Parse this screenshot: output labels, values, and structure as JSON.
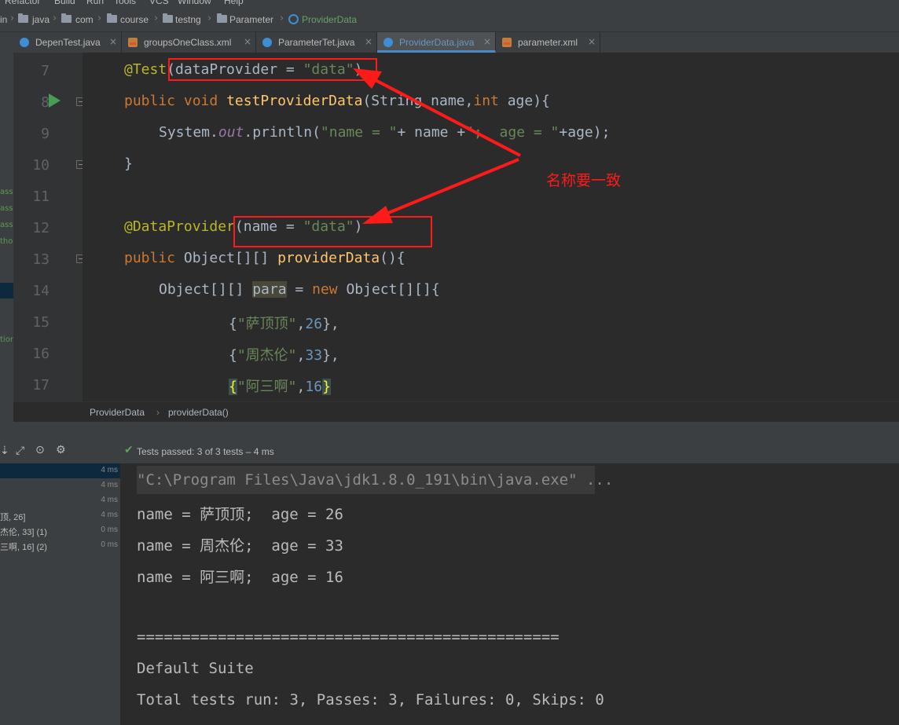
{
  "menu": [
    "Refactor",
    "Build",
    "Run",
    "Tools",
    "VCS",
    "Window",
    "Help"
  ],
  "breadcrumb": [
    "in",
    "java",
    "com",
    "course",
    "testng",
    "Parameter",
    "ProviderData"
  ],
  "tabs": [
    {
      "label": "DepenTest.java",
      "icon": "java-class-icon",
      "active": false
    },
    {
      "label": "groupsOneClass.xml",
      "icon": "xml-file-icon",
      "active": false
    },
    {
      "label": "ParameterTet.java",
      "icon": "java-class-icon",
      "active": false
    },
    {
      "label": "ProviderData.java",
      "icon": "java-class-icon",
      "active": true
    },
    {
      "label": "parameter.xml",
      "icon": "xml-file-icon",
      "active": false
    }
  ],
  "left_edge_labels": [
    "ass",
    "ass",
    "ass",
    "tho",
    "tion"
  ],
  "line_numbers": [
    "7",
    "8",
    "9",
    "10",
    "11",
    "12",
    "13",
    "14",
    "15",
    "16",
    "17"
  ],
  "code": {
    "l7": {
      "ann": "@Test",
      "rest": "(dataProvider = ",
      "str": "\"data\"",
      "end": ")"
    },
    "l8": {
      "kw1": "public",
      "kw2": "void",
      "name": "testProviderData",
      "p1": "(String name,",
      "kw3": "int",
      "p2": " age){"
    },
    "l9": {
      "pre": "System.",
      "fld": "out",
      "mid": ".println(",
      "s1": "\"name = \"",
      "mid2": "+ name +",
      "s2": "\";  age = \"",
      "end": "+age);"
    },
    "l10": "}",
    "l12": {
      "ann": "@DataProvider",
      "rest": "(name = ",
      "str": "\"data\"",
      "end": ")"
    },
    "l13": {
      "kw": "public",
      "type": " Object[][] ",
      "name": "providerData",
      "end": "(){"
    },
    "l14": {
      "pre": "Object[][] ",
      "var": "para",
      "mid": " = ",
      "kw": "new",
      "end": " Object[][]{"
    },
    "l15": {
      "s": "\"萨顶顶\"",
      "n": "26"
    },
    "l16": {
      "s": "\"周杰伦\"",
      "n": "33"
    },
    "l17": {
      "s": "\"阿三啊\"",
      "n": "16"
    }
  },
  "status_crumbs": [
    "ProviderData",
    "providerData()"
  ],
  "test_summary": "Tests passed: 3 of 3 tests – 4 ms",
  "tree_rows": [
    {
      "name": "",
      "time": "4 ms",
      "selected": true
    },
    {
      "name": "",
      "time": "4 ms",
      "selected": false
    },
    {
      "name": "",
      "time": "4 ms",
      "selected": false
    },
    {
      "name": "顶, 26]",
      "time": "4 ms",
      "selected": false
    },
    {
      "name": "杰伦, 33] (1)",
      "time": "0 ms",
      "selected": false
    },
    {
      "name": "三啊, 16] (2)",
      "time": "0 ms",
      "selected": false
    }
  ],
  "console": [
    "\"C:\\Program Files\\Java\\jdk1.8.0_191\\bin\\java.exe\" ...",
    "name = 萨顶顶;  age = 26",
    "name = 周杰伦;  age = 33",
    "name = 阿三啊;  age = 16",
    "",
    "===============================================",
    "Default Suite",
    "Total tests run: 3, Passes: 3, Failures: 0, Skips: 0"
  ],
  "annotation_text": "名称要一致",
  "colors": {
    "annotation_red": "#ff1a1a",
    "keyword": "#cc7832",
    "string": "#6a8759",
    "number": "#6897bb",
    "annotation": "#bbb529"
  }
}
